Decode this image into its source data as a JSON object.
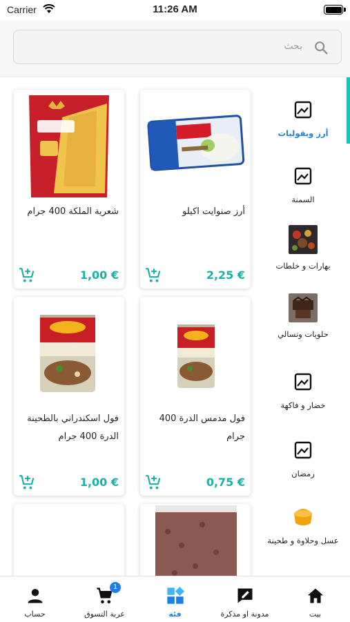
{
  "status_bar": {
    "carrier": "Carrier",
    "time": "11:26 AM"
  },
  "search": {
    "placeholder": "بحث"
  },
  "categories": [
    {
      "label": "أرز وبقوليات",
      "icon": "image-placeholder-icon",
      "active": true
    },
    {
      "label": "السمنة",
      "icon": "image-placeholder-icon"
    },
    {
      "label": "بهارات و خلطات",
      "icon": "spices-photo"
    },
    {
      "label": "حلويات وتسالي",
      "icon": "sweets-photo"
    },
    {
      "label": "خضار و فاكهة",
      "icon": "image-placeholder-icon"
    },
    {
      "label": "رمضان",
      "icon": "image-placeholder-icon"
    },
    {
      "label": "عسل وحلاوة و طحينة",
      "icon": "honey-photo"
    }
  ],
  "products": [
    {
      "name": "أرز صنوايت اكيلو",
      "price": "2,25 €",
      "image": "rice-bag"
    },
    {
      "name": "شعرية الملكة 400 جرام",
      "price": "1,00 €",
      "image": "vermicelli-pack"
    },
    {
      "name": "فول مدمس الدرة 400 جرام",
      "price": "0,75 €",
      "image": "durra-can"
    },
    {
      "name": "فول اسكندراني بالطحينة الدرة 400 جرام",
      "price": "1,00 €",
      "image": "durra-can-large"
    },
    {
      "name": "",
      "price": "",
      "image": "beans-bag"
    },
    {
      "name": "",
      "price": "",
      "image": ""
    }
  ],
  "tabs": [
    {
      "label": "بيت",
      "icon": "home-icon"
    },
    {
      "label": "مدونة او مذكرة",
      "icon": "note-edit-icon"
    },
    {
      "label": "فئة",
      "icon": "category-grid-icon",
      "active": true
    },
    {
      "label": "عربة التسوق",
      "icon": "cart-icon",
      "badge": "1"
    },
    {
      "label": "حساب",
      "icon": "person-icon"
    }
  ],
  "colors": {
    "accent": "#1bc2b7",
    "price": "#1bb0a6",
    "active": "#1f7de6"
  }
}
